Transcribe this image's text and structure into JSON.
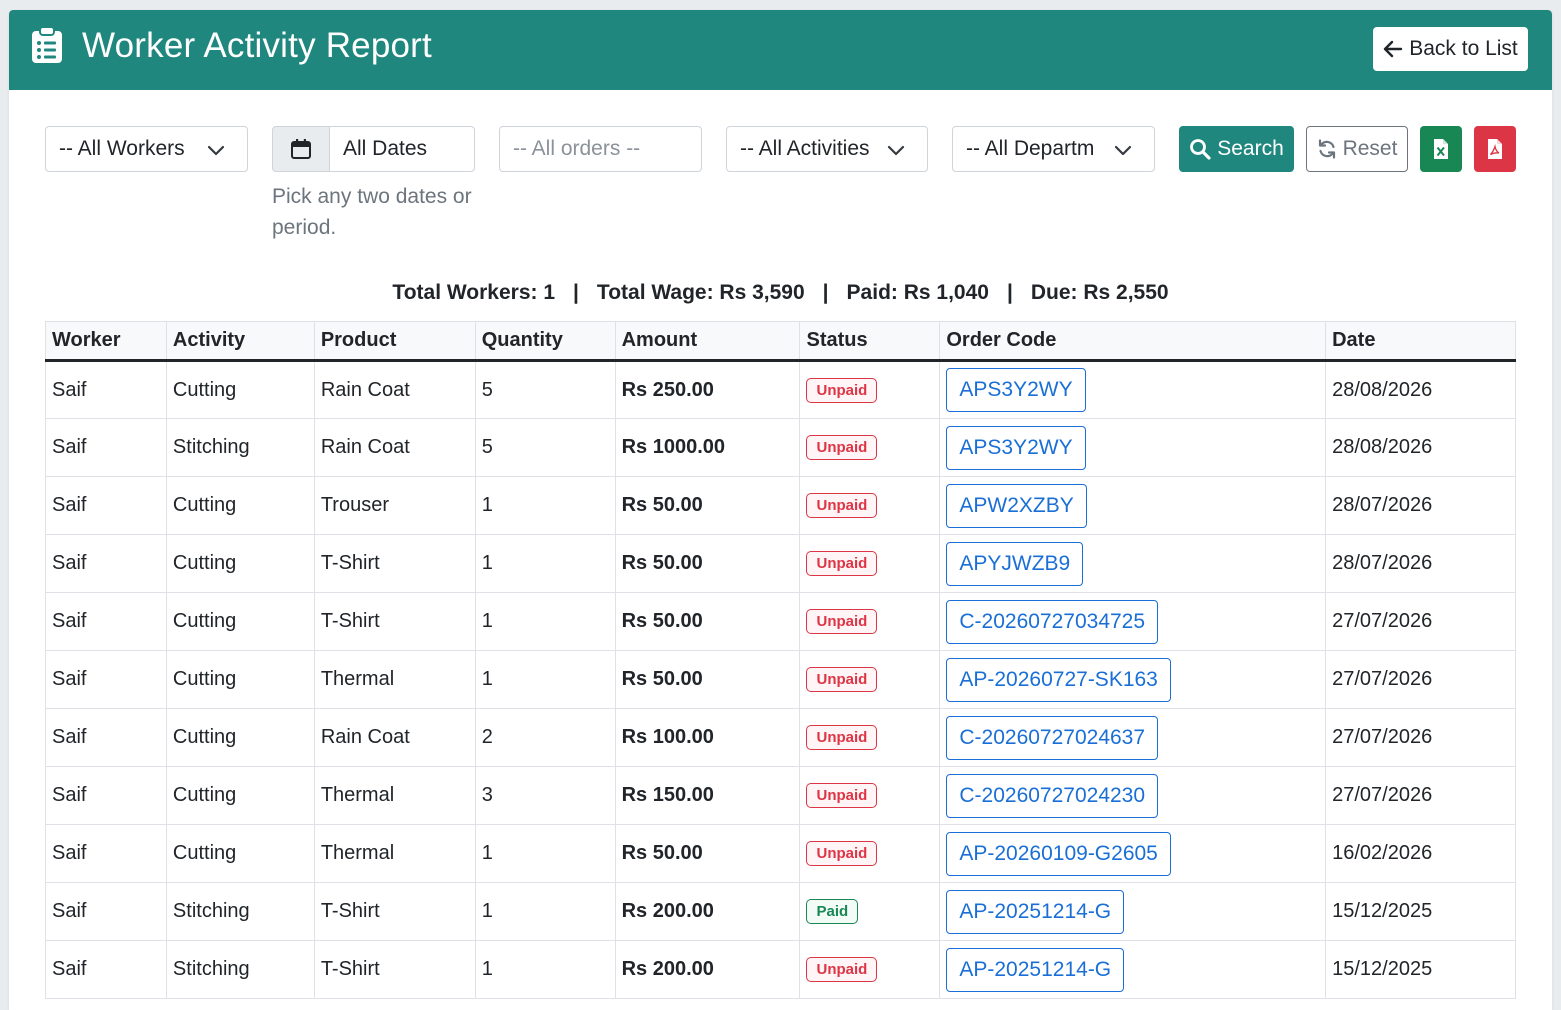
{
  "header": {
    "title": "Worker Activity Report",
    "back_label": "Back to List",
    "color": "#20877f"
  },
  "filters": {
    "workers": "-- All Workers",
    "dates": "All Dates",
    "dates_help": "Pick any two dates or period.",
    "orders_placeholder": "-- All orders --",
    "activities": "-- All Activities",
    "departments": "-- All Departm",
    "search_label": "Search",
    "reset_label": "Reset"
  },
  "summary": {
    "total_workers": "Total Workers: 1",
    "total_wage": "Total Wage: Rs 3,590",
    "paid": "Paid: Rs 1,040",
    "due": "Due: Rs 2,550",
    "separator": "|"
  },
  "table": {
    "columns": [
      "Worker",
      "Activity",
      "Product",
      "Quantity",
      "Amount",
      "Status",
      "Order Code",
      "Date"
    ],
    "rows": [
      {
        "worker": "Saif",
        "activity": "Cutting",
        "product": "Rain Coat",
        "quantity": "5",
        "amount": "Rs 250.00",
        "status": "Unpaid",
        "order_code": "APS3Y2WY",
        "date": "28/08/2026"
      },
      {
        "worker": "Saif",
        "activity": "Stitching",
        "product": "Rain Coat",
        "quantity": "5",
        "amount": "Rs 1000.00",
        "status": "Unpaid",
        "order_code": "APS3Y2WY",
        "date": "28/08/2026"
      },
      {
        "worker": "Saif",
        "activity": "Cutting",
        "product": "Trouser",
        "quantity": "1",
        "amount": "Rs 50.00",
        "status": "Unpaid",
        "order_code": "APW2XZBY",
        "date": "28/07/2026"
      },
      {
        "worker": "Saif",
        "activity": "Cutting",
        "product": "T-Shirt",
        "quantity": "1",
        "amount": "Rs 50.00",
        "status": "Unpaid",
        "order_code": "APYJWZB9",
        "date": "28/07/2026"
      },
      {
        "worker": "Saif",
        "activity": "Cutting",
        "product": "T-Shirt",
        "quantity": "1",
        "amount": "Rs 50.00",
        "status": "Unpaid",
        "order_code": "C-20260727034725",
        "date": "27/07/2026"
      },
      {
        "worker": "Saif",
        "activity": "Cutting",
        "product": "Thermal",
        "quantity": "1",
        "amount": "Rs 50.00",
        "status": "Unpaid",
        "order_code": "AP-20260727-SK163",
        "date": "27/07/2026"
      },
      {
        "worker": "Saif",
        "activity": "Cutting",
        "product": "Rain Coat",
        "quantity": "2",
        "amount": "Rs 100.00",
        "status": "Unpaid",
        "order_code": "C-20260727024637",
        "date": "27/07/2026"
      },
      {
        "worker": "Saif",
        "activity": "Cutting",
        "product": "Thermal",
        "quantity": "3",
        "amount": "Rs 150.00",
        "status": "Unpaid",
        "order_code": "C-20260727024230",
        "date": "27/07/2026"
      },
      {
        "worker": "Saif",
        "activity": "Cutting",
        "product": "Thermal",
        "quantity": "1",
        "amount": "Rs 50.00",
        "status": "Unpaid",
        "order_code": "AP-20260109-G2605",
        "date": "16/02/2026"
      },
      {
        "worker": "Saif",
        "activity": "Stitching",
        "product": "T-Shirt",
        "quantity": "1",
        "amount": "Rs 200.00",
        "status": "Paid",
        "order_code": "AP-20251214-G",
        "date": "15/12/2025"
      },
      {
        "worker": "Saif",
        "activity": "Stitching",
        "product": "T-Shirt",
        "quantity": "1",
        "amount": "Rs 200.00",
        "status": "Unpaid",
        "order_code": "AP-20251214-G",
        "date": "15/12/2025"
      }
    ]
  }
}
